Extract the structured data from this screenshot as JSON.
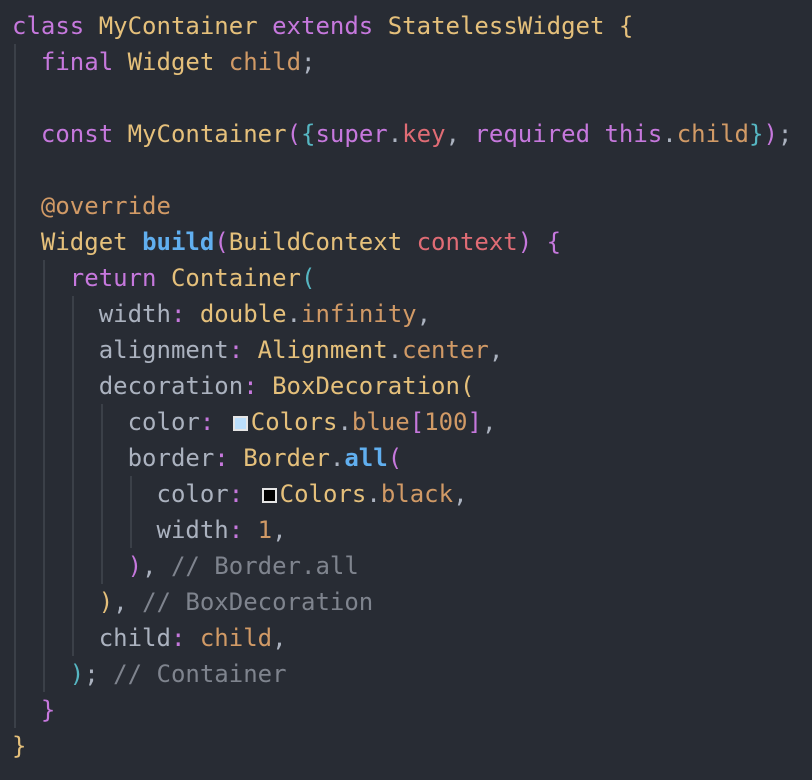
{
  "editor": {
    "language": "dart",
    "theme_colors": {
      "background": "#282c34",
      "keyword": "#c678dd",
      "type": "#e5c07b",
      "field": "#d19a66",
      "parameter": "#e06c75",
      "function": "#61afef",
      "comment": "#7f848e",
      "plain": "#abb2bf",
      "swatch_blue100": "#bbdefb",
      "swatch_black": "#000000"
    },
    "lines": [
      {
        "indent": 0,
        "tokens": [
          [
            "kw",
            "class"
          ],
          [
            "pl",
            " "
          ],
          [
            "ty",
            "MyContainer"
          ],
          [
            "pl",
            " "
          ],
          [
            "kw",
            "extends"
          ],
          [
            "pl",
            " "
          ],
          [
            "ty",
            "StatelessWidget"
          ],
          [
            "pl",
            " "
          ],
          [
            "b1",
            "{"
          ]
        ]
      },
      {
        "indent": 1,
        "tokens": [
          [
            "kw",
            "final"
          ],
          [
            "pl",
            " "
          ],
          [
            "ty",
            "Widget"
          ],
          [
            "pl",
            " "
          ],
          [
            "fld",
            "child"
          ],
          [
            "pl",
            ";"
          ]
        ]
      },
      {
        "indent": 1,
        "tokens": []
      },
      {
        "indent": 1,
        "tokens": [
          [
            "kw",
            "const"
          ],
          [
            "pl",
            " "
          ],
          [
            "ty",
            "MyContainer"
          ],
          [
            "b2",
            "("
          ],
          [
            "b3",
            "{"
          ],
          [
            "kw",
            "super"
          ],
          [
            "pl",
            "."
          ],
          [
            "par",
            "key"
          ],
          [
            "pl",
            ", "
          ],
          [
            "kw",
            "required"
          ],
          [
            "pl",
            " "
          ],
          [
            "kw",
            "this"
          ],
          [
            "pl",
            "."
          ],
          [
            "fld",
            "child"
          ],
          [
            "b3",
            "}"
          ],
          [
            "b2",
            ")"
          ],
          [
            "pl",
            ";"
          ]
        ]
      },
      {
        "indent": 1,
        "tokens": []
      },
      {
        "indent": 1,
        "tokens": [
          [
            "dec",
            "@override"
          ]
        ]
      },
      {
        "indent": 1,
        "tokens": [
          [
            "ty",
            "Widget"
          ],
          [
            "pl",
            " "
          ],
          [
            "fn",
            "build"
          ],
          [
            "b2",
            "("
          ],
          [
            "ty",
            "BuildContext"
          ],
          [
            "pl",
            " "
          ],
          [
            "par",
            "context"
          ],
          [
            "b2",
            ")"
          ],
          [
            "pl",
            " "
          ],
          [
            "b2",
            "{"
          ]
        ]
      },
      {
        "indent": 2,
        "tokens": [
          [
            "kw",
            "return"
          ],
          [
            "pl",
            " "
          ],
          [
            "ty",
            "Container"
          ],
          [
            "b3",
            "("
          ]
        ]
      },
      {
        "indent": 3,
        "tokens": [
          [
            "prop",
            "width"
          ],
          [
            "kw",
            ":"
          ],
          [
            "pl",
            " "
          ],
          [
            "ty",
            "double"
          ],
          [
            "pl",
            "."
          ],
          [
            "fld",
            "infinity"
          ],
          [
            "pl",
            ","
          ]
        ]
      },
      {
        "indent": 3,
        "tokens": [
          [
            "prop",
            "alignment"
          ],
          [
            "kw",
            ":"
          ],
          [
            "pl",
            " "
          ],
          [
            "ty",
            "Alignment"
          ],
          [
            "pl",
            "."
          ],
          [
            "fld",
            "center"
          ],
          [
            "pl",
            ","
          ]
        ]
      },
      {
        "indent": 3,
        "tokens": [
          [
            "prop",
            "decoration"
          ],
          [
            "kw",
            ":"
          ],
          [
            "pl",
            " "
          ],
          [
            "ty",
            "BoxDecoration"
          ],
          [
            "b1",
            "("
          ]
        ]
      },
      {
        "indent": 4,
        "tokens": [
          [
            "prop",
            "color"
          ],
          [
            "kw",
            ":"
          ],
          [
            "pl",
            " "
          ],
          [
            "swatch",
            "#bbdefb"
          ],
          [
            "ty",
            "Colors"
          ],
          [
            "pl",
            "."
          ],
          [
            "fld",
            "blue"
          ],
          [
            "b2",
            "["
          ],
          [
            "num",
            "100"
          ],
          [
            "b2",
            "]"
          ],
          [
            "pl",
            ","
          ]
        ]
      },
      {
        "indent": 4,
        "tokens": [
          [
            "prop",
            "border"
          ],
          [
            "kw",
            ":"
          ],
          [
            "pl",
            " "
          ],
          [
            "ty",
            "Border"
          ],
          [
            "pl",
            "."
          ],
          [
            "fn",
            "all"
          ],
          [
            "b2",
            "("
          ]
        ]
      },
      {
        "indent": 5,
        "tokens": [
          [
            "prop",
            "color"
          ],
          [
            "kw",
            ":"
          ],
          [
            "pl",
            " "
          ],
          [
            "swatch",
            "#000000"
          ],
          [
            "ty",
            "Colors"
          ],
          [
            "pl",
            "."
          ],
          [
            "fld",
            "black"
          ],
          [
            "pl",
            ","
          ]
        ]
      },
      {
        "indent": 5,
        "tokens": [
          [
            "prop",
            "width"
          ],
          [
            "kw",
            ":"
          ],
          [
            "pl",
            " "
          ],
          [
            "num",
            "1"
          ],
          [
            "pl",
            ","
          ]
        ]
      },
      {
        "indent": 4,
        "tokens": [
          [
            "b2",
            ")"
          ],
          [
            "pl",
            ", "
          ],
          [
            "cm",
            "// Border.all"
          ]
        ]
      },
      {
        "indent": 3,
        "tokens": [
          [
            "b1",
            ")"
          ],
          [
            "pl",
            ", "
          ],
          [
            "cm",
            "// BoxDecoration"
          ]
        ]
      },
      {
        "indent": 3,
        "tokens": [
          [
            "prop",
            "child"
          ],
          [
            "kw",
            ":"
          ],
          [
            "pl",
            " "
          ],
          [
            "fld",
            "child"
          ],
          [
            "pl",
            ","
          ]
        ]
      },
      {
        "indent": 2,
        "tokens": [
          [
            "b3",
            ")"
          ],
          [
            "pl",
            "; "
          ],
          [
            "cm",
            "// Container"
          ]
        ]
      },
      {
        "indent": 1,
        "tokens": [
          [
            "b2",
            "}"
          ]
        ]
      },
      {
        "indent": 0,
        "tokens": [
          [
            "b1",
            "}"
          ]
        ]
      }
    ]
  }
}
